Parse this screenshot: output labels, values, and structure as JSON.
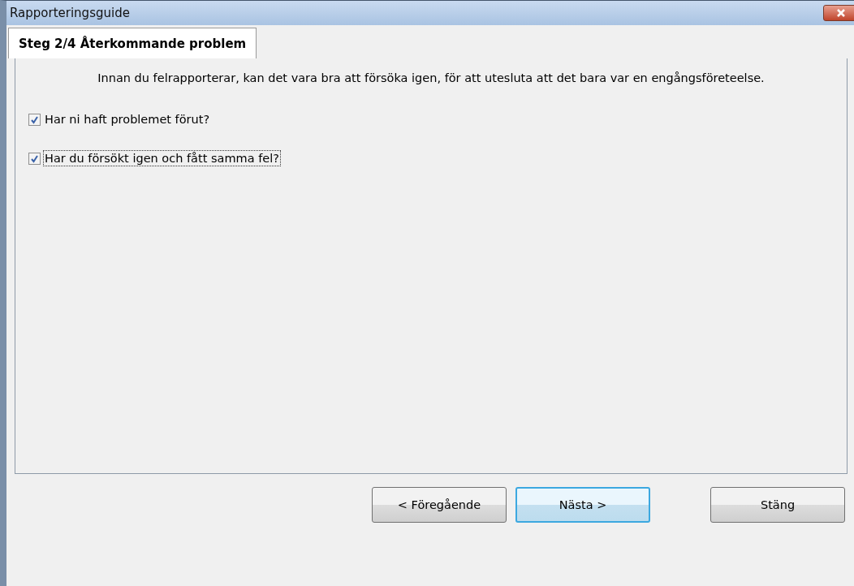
{
  "window": {
    "title": "Rapporteringsguide"
  },
  "tabs": [
    {
      "label": "Steg 2/4 Återkommande problem",
      "selected": true
    }
  ],
  "intro": "Innan du felrapporterar, kan det vara bra att försöka igen, för att utesluta att det bara var en engångsföreteelse.",
  "checkboxes": [
    {
      "label": "Har ni haft problemet förut?",
      "checked": true,
      "focused": false
    },
    {
      "label": "Har du försökt igen och fått samma fel?",
      "checked": true,
      "focused": true
    }
  ],
  "buttons": [
    {
      "label": "< Föregående",
      "default": false
    },
    {
      "label": "Nästa >",
      "default": true
    },
    {
      "label": "Stäng",
      "default": false
    }
  ]
}
